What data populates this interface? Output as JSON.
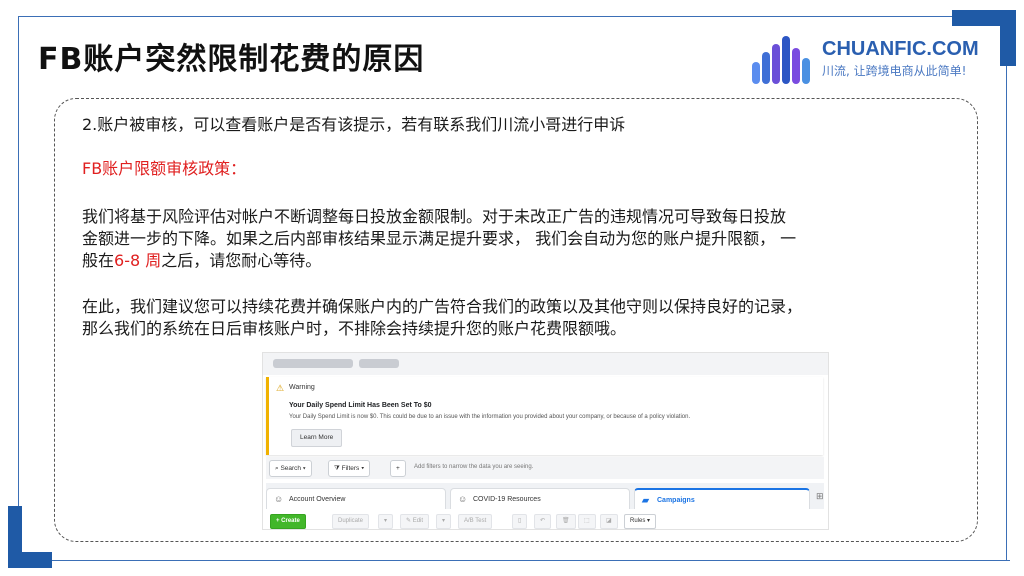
{
  "title": "FB账户突然限制花费的原因",
  "logo": {
    "name": "CHUANFIC.COM",
    "slogan": "川流, 让跨境电商从此简单!",
    "bar_colors": [
      "#5b8def",
      "#3f6fd6",
      "#6b4fd8",
      "#2c56c4",
      "#7a4be0",
      "#4a90e2"
    ]
  },
  "content": {
    "point": "2.账户被审核，可以查看账户是否有该提示，若有联系我们川流小哥进行申诉",
    "policy_heading": "FB账户限额审核政策：",
    "para1_line1": "我们将基于风险评估对帐户不断调整每日投放金额限制。对于未改正广告的违规情况可导致每日投放",
    "para1_line2": "金额进一步的下降。如果之后内部审核结果显示满足提升要求， 我们会自动为您的账户提升限额， 一",
    "para1_line3_a": "般在",
    "para1_line3_red": "6-8 周",
    "para1_line3_b": "之后，请您耐心等待。",
    "para2_line1": "在此，我们建议您可以持续花费并确保账户内的广告符合我们的政策以及其他守则以保持良好的记录，",
    "para2_line2": "那么我们的系统在日后审核账户时，不排除会持续提升您的账户花费限额哦。"
  },
  "screenshot": {
    "warning_label": "Warning",
    "warning_title": "Your Daily Spend Limit Has Been Set To $0",
    "warning_text": "Your Daily Spend Limit is now $0. This could be due to an issue with the information you provided about your company, or because of a policy violation.",
    "learn_more": "Learn More",
    "search": "Search ▾",
    "filters": "Filters ▾",
    "add": "+",
    "filter_hint": "Add filters to narrow the data you are seeing.",
    "tabs": [
      "Account Overview",
      "COVID-19 Resources",
      "Campaigns"
    ],
    "actions": {
      "create": "+ Create",
      "duplicate": "Duplicate",
      "edit": "✎ Edit",
      "ab_test": "A/B Test",
      "rules": "Rules ▾"
    }
  }
}
